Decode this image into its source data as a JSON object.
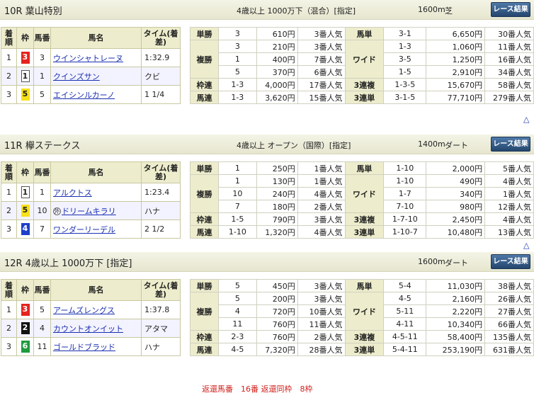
{
  "result_button_label": "レース結果",
  "up_label": "△",
  "table_headers": {
    "rank": "着順",
    "gate": "枠",
    "number": "馬番",
    "name": "馬名",
    "time": "タイム(着差)"
  },
  "races": [
    {
      "title": "10R 葉山特別",
      "conditions": "4歳以上 1000万下（混合）[指定]",
      "distance": "1600m",
      "surface": "芝",
      "horses": [
        {
          "rank": "1",
          "gate": "3",
          "gate_color": "red",
          "number": "3",
          "name": "ウインシャトレーヌ",
          "time": "1:32.9"
        },
        {
          "rank": "2",
          "gate": "1",
          "gate_color": "white",
          "number": "1",
          "name": "クインズサン",
          "time": "クビ"
        },
        {
          "rank": "3",
          "gate": "5",
          "gate_color": "yellow",
          "number": "5",
          "name": "エイシンルカーノ",
          "time": "1 1/4"
        }
      ],
      "payouts": {
        "tansho": {
          "label": "単勝",
          "num": "3",
          "yen": "610円",
          "pop": "3番人気"
        },
        "fukusho": {
          "label": "複勝",
          "rows": [
            {
              "num": "3",
              "yen": "210円",
              "pop": "3番人気"
            },
            {
              "num": "1",
              "yen": "400円",
              "pop": "7番人気"
            },
            {
              "num": "5",
              "yen": "370円",
              "pop": "6番人気"
            }
          ]
        },
        "wakuren": {
          "label": "枠連",
          "num": "1-3",
          "yen": "4,000円",
          "pop": "17番人気"
        },
        "umaren": {
          "label": "馬連",
          "num": "1-3",
          "yen": "3,620円",
          "pop": "15番人気"
        },
        "umatan": {
          "label": "馬単",
          "num": "3-1",
          "yen": "6,650円",
          "pop": "30番人気"
        },
        "wide": {
          "label": "ワイド",
          "rows": [
            {
              "num": "1-3",
              "yen": "1,060円",
              "pop": "11番人気"
            },
            {
              "num": "3-5",
              "yen": "1,250円",
              "pop": "16番人気"
            },
            {
              "num": "1-5",
              "yen": "2,910円",
              "pop": "34番人気"
            }
          ]
        },
        "sanrenpuku": {
          "label": "3連複",
          "num": "1-3-5",
          "yen": "15,670円",
          "pop": "58番人気"
        },
        "sanrentan": {
          "label": "3連単",
          "num": "3-1-5",
          "yen": "77,710円",
          "pop": "279番人気"
        }
      }
    },
    {
      "title": "11R 欅ステークス",
      "conditions": "4歳以上 オープン（国際）[指定]",
      "distance": "1400m",
      "surface": "ダート",
      "horses": [
        {
          "rank": "1",
          "gate": "1",
          "gate_color": "white",
          "number": "1",
          "name": "アルクトス",
          "time": "1:23.4"
        },
        {
          "rank": "2",
          "gate": "5",
          "gate_color": "yellow",
          "number": "10",
          "name": "ドリームキラリ",
          "time": "ハナ",
          "foreign": "外"
        },
        {
          "rank": "3",
          "gate": "4",
          "gate_color": "blue",
          "number": "7",
          "name": "ワンダーリーデル",
          "time": "2 1/2"
        }
      ],
      "payouts": {
        "tansho": {
          "label": "単勝",
          "num": "1",
          "yen": "250円",
          "pop": "1番人気"
        },
        "fukusho": {
          "label": "複勝",
          "rows": [
            {
              "num": "1",
              "yen": "130円",
              "pop": "1番人気"
            },
            {
              "num": "10",
              "yen": "240円",
              "pop": "4番人気"
            },
            {
              "num": "7",
              "yen": "180円",
              "pop": "2番人気"
            }
          ]
        },
        "wakuren": {
          "label": "枠連",
          "num": "1-5",
          "yen": "790円",
          "pop": "3番人気"
        },
        "umaren": {
          "label": "馬連",
          "num": "1-10",
          "yen": "1,320円",
          "pop": "4番人気"
        },
        "umatan": {
          "label": "馬単",
          "num": "1-10",
          "yen": "2,000円",
          "pop": "5番人気"
        },
        "wide": {
          "label": "ワイド",
          "rows": [
            {
              "num": "1-10",
              "yen": "490円",
              "pop": "4番人気"
            },
            {
              "num": "1-7",
              "yen": "340円",
              "pop": "1番人気"
            },
            {
              "num": "7-10",
              "yen": "980円",
              "pop": "12番人気"
            }
          ]
        },
        "sanrenpuku": {
          "label": "3連複",
          "num": "1-7-10",
          "yen": "2,450円",
          "pop": "4番人気"
        },
        "sanrentan": {
          "label": "3連単",
          "num": "1-10-7",
          "yen": "10,480円",
          "pop": "13番人気"
        }
      }
    },
    {
      "title": "12R 4歳以上 1000万下 [指定]",
      "conditions": "",
      "distance": "1600m",
      "surface": "ダート",
      "horses": [
        {
          "rank": "1",
          "gate": "3",
          "gate_color": "red",
          "number": "5",
          "name": "アームズレングス",
          "time": "1:37.8"
        },
        {
          "rank": "2",
          "gate": "2",
          "gate_color": "black",
          "number": "4",
          "name": "カウントオンイット",
          "time": "アタマ"
        },
        {
          "rank": "3",
          "gate": "6",
          "gate_color": "green",
          "number": "11",
          "name": "ゴールドブラッド",
          "time": "ハナ"
        }
      ],
      "payouts": {
        "tansho": {
          "label": "単勝",
          "num": "5",
          "yen": "450円",
          "pop": "3番人気"
        },
        "fukusho": {
          "label": "複勝",
          "rows": [
            {
              "num": "5",
              "yen": "200円",
              "pop": "3番人気"
            },
            {
              "num": "4",
              "yen": "720円",
              "pop": "10番人気"
            },
            {
              "num": "11",
              "yen": "760円",
              "pop": "11番人気"
            }
          ]
        },
        "wakuren": {
          "label": "枠連",
          "num": "2-3",
          "yen": "760円",
          "pop": "2番人気"
        },
        "umaren": {
          "label": "馬連",
          "num": "4-5",
          "yen": "7,320円",
          "pop": "28番人気"
        },
        "umatan": {
          "label": "馬単",
          "num": "5-4",
          "yen": "11,030円",
          "pop": "38番人気"
        },
        "wide": {
          "label": "ワイド",
          "rows": [
            {
              "num": "4-5",
              "yen": "2,160円",
              "pop": "26番人気"
            },
            {
              "num": "5-11",
              "yen": "2,220円",
              "pop": "27番人気"
            },
            {
              "num": "4-11",
              "yen": "10,340円",
              "pop": "66番人気"
            }
          ]
        },
        "sanrenpuku": {
          "label": "3連複",
          "num": "4-5-11",
          "yen": "58,400円",
          "pop": "135番人気"
        },
        "sanrentan": {
          "label": "3連単",
          "num": "5-4-11",
          "yen": "253,190円",
          "pop": "631番人気"
        }
      },
      "note": "返還馬番　16番 返還同枠　8枠"
    }
  ]
}
